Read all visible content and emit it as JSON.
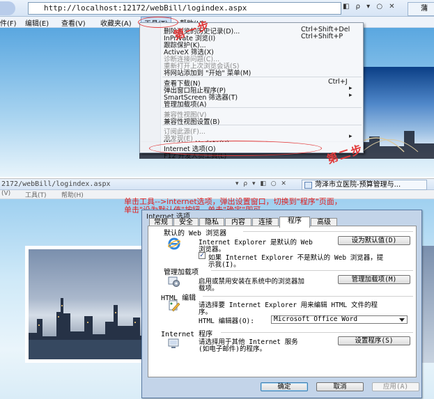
{
  "top": {
    "address": "http://localhost:12172/webBill/logindex.aspx",
    "address_controls": "◧ ρ ▾ ○ ✕",
    "tab_label": "蒲",
    "menubar": [
      "件(F)",
      "编辑(E)",
      "查看(V)",
      "收藏夹(A)",
      "工具(T)",
      "帮助(H)"
    ],
    "dropdown": [
      {
        "label": "删除浏览的历史记录(D)...",
        "shortcut": "Ctrl+Shift+Del",
        "disabled": false
      },
      {
        "label": "InPrivate 浏览(I)",
        "shortcut": "Ctrl+Shift+P",
        "disabled": false
      },
      {
        "label": "跟踪保护(K)...",
        "shortcut": "",
        "disabled": false
      },
      {
        "label": "ActiveX 筛选(X)",
        "shortcut": "",
        "disabled": false
      },
      {
        "label": "诊断连接问题(C)...",
        "shortcut": "",
        "disabled": true
      },
      {
        "label": "重新打开上次浏览会话(S)",
        "shortcut": "",
        "disabled": true
      },
      {
        "label": "将网站添加到 \"开始\" 菜单(M)",
        "shortcut": "",
        "disabled": false
      },
      {
        "label": "查看下载(N)",
        "shortcut": "Ctrl+J",
        "disabled": false
      },
      {
        "label": "弹出窗口阻止程序(P)",
        "shortcut": "",
        "disabled": false
      },
      {
        "label": "SmartScreen 筛选器(T)",
        "shortcut": "",
        "disabled": false
      },
      {
        "label": "管理加载项(A)",
        "shortcut": "",
        "disabled": false
      },
      {
        "label": "兼容性视图(V)",
        "shortcut": "",
        "disabled": true
      },
      {
        "label": "兼容性视图设置(B)",
        "shortcut": "",
        "disabled": false
      },
      {
        "label": "订阅此源(F)...",
        "shortcut": "",
        "disabled": true
      },
      {
        "label": "源发现(E)",
        "shortcut": "",
        "disabled": true
      },
      {
        "label": "Windows Update(U)",
        "shortcut": "",
        "disabled": false
      },
      {
        "label": "F12 开发人员工具(L)",
        "shortcut": "",
        "disabled": false
      },
      {
        "label": "Internet 选项(O)",
        "shortcut": "",
        "disabled": false
      }
    ],
    "annotations": {
      "step1": "第一步",
      "step2": "第二步"
    }
  },
  "bottom": {
    "address": "2172/webBill/logindex.aspx",
    "controls": "▾ ρ ▾ ◧ ○ ✕",
    "tab_label": "菏泽市立医院-预算管理与...",
    "menubar": [
      "(V)",
      "工具(T)",
      "帮助(H)"
    ],
    "instruction": [
      "单击工具-->internet选项，弹出设置窗口，切换到\"程序\"页面，",
      "单击\"设为默认值\"按钮，单击\"确定\"即可。"
    ],
    "dialog": {
      "title": "Internet 选项",
      "tabs": [
        "常规",
        "安全",
        "隐私",
        "内容",
        "连接",
        "程序",
        "高级"
      ],
      "active_tab": "程序",
      "groups": {
        "default_browser": {
          "title": "默认的 Web 浏览器",
          "text_line1": "Internet Explorer 是默认的 Web",
          "text_line2": "浏览器。",
          "button": "设为默认值(D)",
          "check_label_line1": "如果 Internet Explorer 不是默认的 Web 浏览器，提",
          "check_label_line2": "示我(I)。",
          "checked": true
        },
        "addons": {
          "title": "管理加载项",
          "text_line1": "启用或禁用安装在系统中的浏览器加",
          "text_line2": "载项。",
          "button": "管理加载项(M)"
        },
        "html_editing": {
          "title": "HTML 编辑",
          "text_line1": "请选择要 Internet Explorer 用来编辑 HTML 文件的程",
          "text_line2": "序。",
          "select_label": "HTML 编辑器(O):",
          "select_value": "Microsoft Office Word"
        },
        "internet_programs": {
          "title": "Internet 程序",
          "text_line1": "请选择用于其他 Internet 服务",
          "text_line2": "(如电子邮件)的程序。",
          "button": "设置程序(S)"
        }
      },
      "ok": "确定",
      "cancel": "取消",
      "apply": "应用(A)"
    }
  },
  "colors": {
    "annotation_red": "#e23a3a",
    "dialog_frame": "#c3d4e9",
    "ie_bar": "#d6e4f5"
  }
}
